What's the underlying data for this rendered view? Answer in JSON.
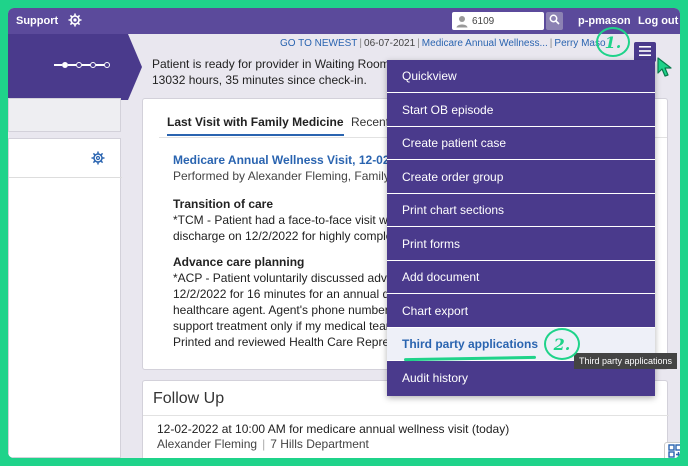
{
  "topbar": {
    "support": "Support",
    "search_value": "6109",
    "username": "p-pmason",
    "logout": "Log out"
  },
  "breadcrumb": {
    "go_to_newest": "GO TO NEWEST",
    "date": "06-07-2021",
    "visit": "Medicare Annual Wellness...",
    "provider": "Perry Maso"
  },
  "patient_status": {
    "line1": "Patient is ready for provider in Waiting Room",
    "line2": "13032 hours, 35 minutes since check-in."
  },
  "tabs": {
    "active": "Last Visit with Family Medicine",
    "second": "Recent"
  },
  "visit": {
    "title": "Medicare Annual Wellness Visit, 12-02-2...",
    "performed_by": "Performed by Alexander Fleming, Family M"
  },
  "transition": {
    "title": "Transition of care",
    "line1": "*TCM - Patient had a face-to-face visit with",
    "line2": "discharge on 12/2/2022 for highly complex"
  },
  "advance": {
    "title": "Advance care planning",
    "line1": "*ACP - Patient voluntarily discussed advan",
    "line2": "12/2/2022 for 16 minutes for an annual dis",
    "line3": "healthcare agent. Agent's phone number is",
    "line4": "support treatment only if my medical team",
    "line5": "Printed and reviewed Health Care Represe"
  },
  "follow_up": {
    "title": "Follow Up",
    "line1": "12-02-2022 at 10:00 AM for medicare annual wellness visit (today)",
    "provider": "Alexander Fleming",
    "department": "7 Hills Department"
  },
  "menu": {
    "items": [
      "Quickview",
      "Start OB episode",
      "Create patient case",
      "Create order group",
      "Print chart sections",
      "Print forms",
      "Add document",
      "Chart export",
      "Third party applications",
      "Audit history"
    ],
    "highlighted_index": 8
  },
  "tooltip": "Third party applications",
  "annotations": {
    "step1": "1.",
    "step2": "2."
  },
  "colors": {
    "brand_purple": "#4a3a8c",
    "topbar_purple": "#5b4a9b",
    "link_blue": "#2a64b0",
    "annotation_green": "#1fd38a"
  },
  "icons": [
    "gear-icon",
    "user-icon",
    "search-icon",
    "hamburger-icon",
    "settings-icon",
    "grid-add-icon",
    "cursor-icon"
  ]
}
